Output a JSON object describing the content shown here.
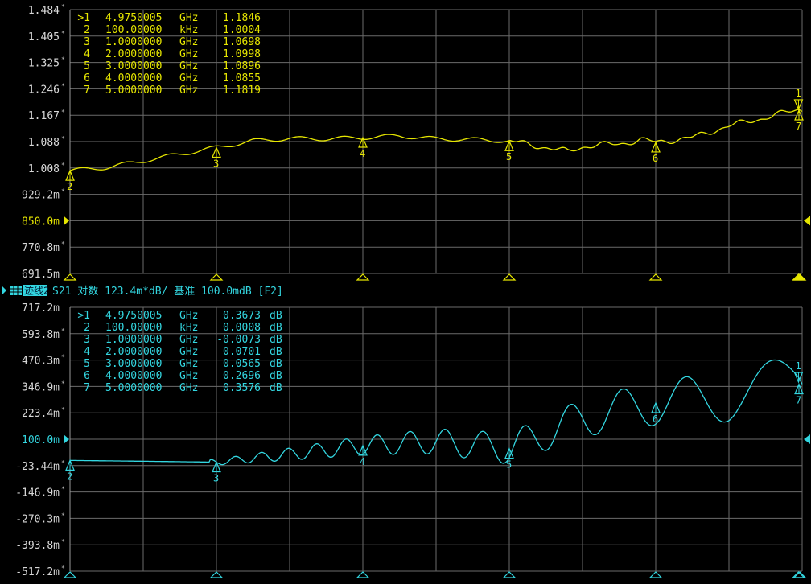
{
  "panels": [
    {
      "id": "top",
      "trace_color": "#e6e600",
      "ref_label": "850.0m",
      "y_ticks": [
        "1.484",
        "1.405",
        "1.325",
        "1.246",
        "1.167",
        "1.088",
        "1.008",
        "929.2m",
        "850.0m",
        "770.8m",
        "691.5m"
      ],
      "tick_marks": [
        true,
        true,
        true,
        true,
        true,
        true,
        true,
        true,
        false,
        true,
        false
      ],
      "y_min": 0.6915,
      "y_max": 1.484,
      "markers": [
        {
          "id": ">1",
          "freq": "4.9750005",
          "unit": "GHz",
          "value": "1.1846",
          "value_unit": "",
          "x": 4.9750005,
          "y": 1.1846
        },
        {
          "id": "2",
          "freq": "100.00000",
          "unit": "kHz",
          "value": "1.0004",
          "value_unit": "",
          "x": 0.0001,
          "y": 1.0004
        },
        {
          "id": "3",
          "freq": "1.0000000",
          "unit": "GHz",
          "value": "1.0698",
          "value_unit": "",
          "x": 1.0,
          "y": 1.0698
        },
        {
          "id": "4",
          "freq": "2.0000000",
          "unit": "GHz",
          "value": "1.0998",
          "value_unit": "",
          "x": 2.0,
          "y": 1.0998
        },
        {
          "id": "5",
          "freq": "3.0000000",
          "unit": "GHz",
          "value": "1.0896",
          "value_unit": "",
          "x": 3.0,
          "y": 1.0896
        },
        {
          "id": "6",
          "freq": "4.0000000",
          "unit": "GHz",
          "value": "1.0855",
          "value_unit": "",
          "x": 4.0,
          "y": 1.0855
        },
        {
          "id": "7",
          "freq": "5.0000000",
          "unit": "GHz",
          "value": "1.1819",
          "value_unit": "",
          "x": 5.0,
          "y": 1.1819
        }
      ]
    },
    {
      "id": "bottom",
      "trace_color": "#33d6e0",
      "ref_label": "100.0m",
      "y_ticks": [
        "717.2m",
        "593.8m",
        "470.3m",
        "346.9m",
        "223.4m",
        "100.0m",
        "-23.44m",
        "-146.9m",
        "-270.3m",
        "-393.8m",
        "-517.2m"
      ],
      "tick_marks": [
        false,
        true,
        true,
        true,
        true,
        false,
        true,
        true,
        true,
        true,
        true
      ],
      "y_min": -0.5172,
      "y_max": 0.7172,
      "markers": [
        {
          "id": ">1",
          "freq": "4.9750005",
          "unit": "GHz",
          "value": "0.3673",
          "value_unit": "dB",
          "x": 4.9750005,
          "y": 0.3673
        },
        {
          "id": "2",
          "freq": "100.00000",
          "unit": "kHz",
          "value": "0.0008",
          "value_unit": "dB",
          "x": 0.0001,
          "y": 0.0008
        },
        {
          "id": "3",
          "freq": "1.0000000",
          "unit": "GHz",
          "value": "-0.0073",
          "value_unit": "dB",
          "x": 1.0,
          "y": -0.0073
        },
        {
          "id": "4",
          "freq": "2.0000000",
          "unit": "GHz",
          "value": "0.0701",
          "value_unit": "dB",
          "x": 2.0,
          "y": 0.0701
        },
        {
          "id": "5",
          "freq": "3.0000000",
          "unit": "GHz",
          "value": "0.0565",
          "value_unit": "dB",
          "x": 3.0,
          "y": 0.0565
        },
        {
          "id": "6",
          "freq": "4.0000000",
          "unit": "GHz",
          "value": "0.2696",
          "value_unit": "dB",
          "x": 4.0,
          "y": 0.2696
        },
        {
          "id": "7",
          "freq": "5.0000000",
          "unit": "GHz",
          "value": "0.3576",
          "value_unit": "dB",
          "x": 5.0,
          "y": 0.3576
        }
      ]
    }
  ],
  "trace2_header": {
    "icon": "trace-grid-icon",
    "name": "迹线2",
    "text": "S21 对数 123.4m*dB/ 基准 100.0mdB [F2]"
  },
  "chart_data": [
    {
      "type": "line",
      "xlim": [
        0,
        5
      ],
      "ylim": [
        0.6915,
        1.484
      ],
      "series": [
        {
          "x": [
            0,
            0.25,
            0.5,
            0.75,
            1.0,
            1.25,
            1.5,
            1.75,
            2.0,
            2.25,
            2.5,
            2.75,
            3.0,
            3.1,
            3.25,
            3.4,
            3.5,
            3.6,
            3.75,
            3.9,
            4.0,
            4.25,
            4.5,
            4.75,
            4.975,
            5.0
          ],
          "y": [
            1.0004,
            1.01,
            1.03,
            1.05,
            1.0698,
            1.09,
            1.097,
            1.096,
            1.0998,
            1.105,
            1.096,
            1.094,
            1.0896,
            1.082,
            1.07,
            1.058,
            1.072,
            1.078,
            1.08,
            1.094,
            1.0855,
            1.1,
            1.135,
            1.16,
            1.1846,
            1.1819
          ]
        }
      ]
    },
    {
      "type": "line",
      "xlim": [
        0,
        5
      ],
      "ylim": [
        -0.5172,
        0.7172
      ],
      "series": [
        {
          "x": [
            0,
            0.5,
            1.0,
            1.5,
            2.0,
            2.5,
            3.0,
            3.5,
            4.0,
            4.5,
            4.975,
            5.0
          ],
          "y": [
            0.0008,
            -0.003,
            -0.0073,
            0.03,
            0.0701,
            0.09,
            0.0565,
            0.2,
            0.2696,
            0.3,
            0.3673,
            0.3576
          ]
        }
      ]
    }
  ]
}
